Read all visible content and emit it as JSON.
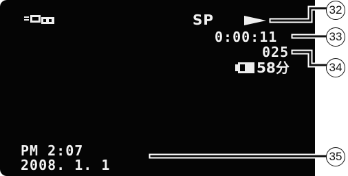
{
  "screen": {
    "mode_icon": "tape-playback-icon",
    "quality": "SP",
    "play_icon": "play-triangle-icon",
    "timecode": "0:00:11",
    "counter": "025",
    "battery": {
      "icon": "battery-icon",
      "remaining": "58分"
    },
    "time": "PM  2:07",
    "date": "2008.  1.  1"
  },
  "callouts": [
    "32",
    "33",
    "34",
    "35"
  ],
  "colors": {
    "screen_background": "#050505",
    "osd_text": "#f2f2f2",
    "callout_line": "#111111"
  }
}
